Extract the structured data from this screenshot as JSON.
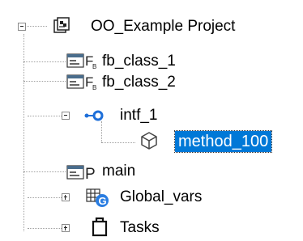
{
  "tree": {
    "root": {
      "label": "OO_Example Project",
      "icon": "project-icon",
      "expanded": true
    },
    "items": [
      {
        "label": "fb_class_1",
        "icon": "function-block-icon"
      },
      {
        "label": "fb_class_2",
        "icon": "function-block-icon"
      },
      {
        "label": "intf_1",
        "icon": "interface-icon",
        "expanded": true
      },
      {
        "label": "method_100",
        "icon": "method-cube-icon",
        "selected": true
      },
      {
        "label": "main",
        "icon": "program-icon"
      },
      {
        "label": "Global_vars",
        "icon": "global-vars-icon",
        "expanded": false
      },
      {
        "label": "Tasks",
        "icon": "tasks-icon",
        "expanded": false
      }
    ]
  },
  "colors": {
    "selection": "#0078d7",
    "interface_blue": "#1e6fd9",
    "globe_blue": "#2a7de1"
  }
}
